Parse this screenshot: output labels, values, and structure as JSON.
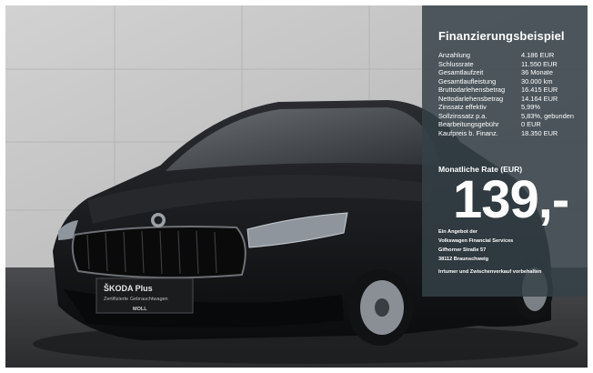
{
  "image": {
    "subject": "black-hatchback-car-photo",
    "plate_logo_text": "ŠKODA Plus",
    "plate_subtitle": "Zertifizierte Gebrauchtwagen",
    "plate_dealer": "MOLL",
    "colors": {
      "panel": "#344048",
      "car": "#0f1114",
      "wall": "#c4c4c4",
      "floor": "#3c3d40"
    }
  },
  "financing": {
    "title": "Finanzierungsbeispiel",
    "rows": [
      {
        "label": "Anzahlung",
        "value": "4.186 EUR"
      },
      {
        "label": "Schlussrate",
        "value": "11.550 EUR"
      },
      {
        "label": "Gesamtlaufzeit",
        "value": "36 Monate"
      },
      {
        "label": "Gesamtlaufleistung",
        "value": "30.000 km"
      },
      {
        "label": "Bruttodarlehensbetrag",
        "value": "16.415 EUR"
      },
      {
        "label": "Nettodarlehensbetrag",
        "value": "14.164 EUR"
      },
      {
        "label": "Zinssatz effektiv",
        "value": "5,99%"
      },
      {
        "label": "Sollzinssatz p.a.",
        "value": "5,83%, gebunden"
      },
      {
        "label": "Bearbeitungsgebühr",
        "value": "0 EUR"
      },
      {
        "label": "Kaufpreis b. Finanz.",
        "value": "18.350 EUR"
      }
    ],
    "monthly_label": "Monatliche Rate (EUR)",
    "monthly_value": "139,-",
    "lender_lines": [
      "Ein Angebot der",
      "Volkswagen Financial Services",
      "Gifhorner Straße 57",
      "38112 Braunschweig"
    ],
    "disclaimer": "Irrtumer und Zwischenverkauf vorbehalten"
  }
}
